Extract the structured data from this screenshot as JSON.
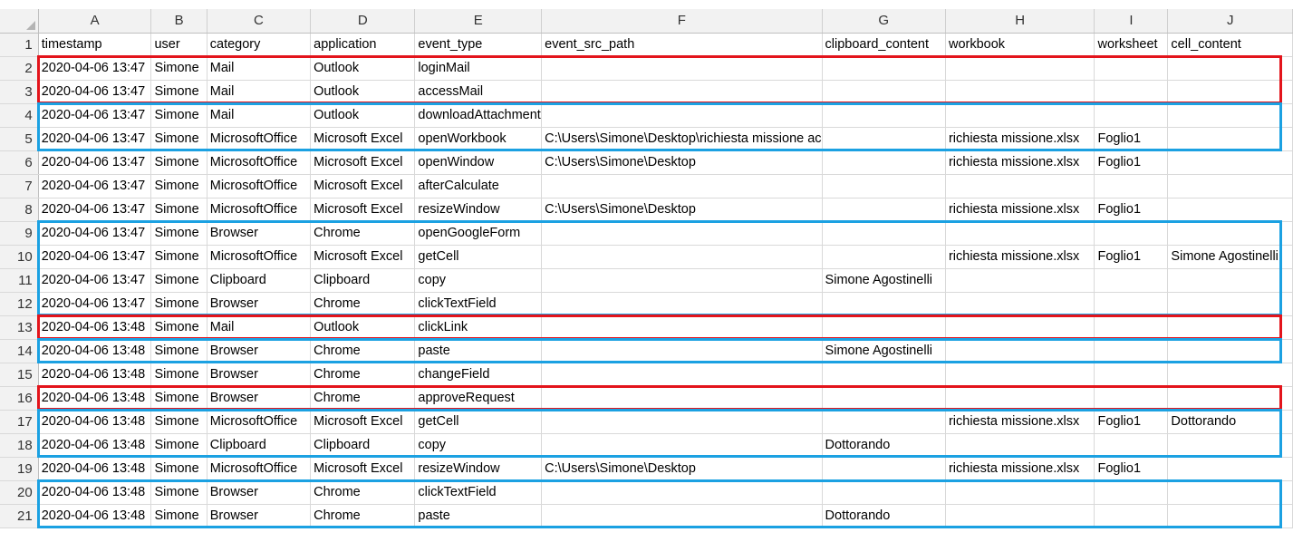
{
  "columns": [
    "A",
    "B",
    "C",
    "D",
    "E",
    "F",
    "G",
    "H",
    "I",
    "J"
  ],
  "rows": [
    {
      "num": "1",
      "cells": [
        "timestamp",
        "user",
        "category",
        "application",
        "event_type",
        "event_src_path",
        "clipboard_content",
        "workbook",
        "worksheet",
        "cell_content"
      ]
    },
    {
      "num": "2",
      "cells": [
        "2020-04-06 13:47",
        "Simone",
        "Mail",
        "Outlook",
        "loginMail",
        "",
        "",
        "",
        "",
        ""
      ]
    },
    {
      "num": "3",
      "cells": [
        "2020-04-06 13:47",
        "Simone",
        "Mail",
        "Outlook",
        "accessMail",
        "",
        "",
        "",
        "",
        ""
      ]
    },
    {
      "num": "4",
      "cells": [
        "2020-04-06 13:47",
        "Simone",
        "Mail",
        "Outlook",
        "downloadAttachment",
        "",
        "",
        "",
        "",
        ""
      ]
    },
    {
      "num": "5",
      "cells": [
        "2020-04-06 13:47",
        "Simone",
        "MicrosoftOffice",
        "Microsoft Excel",
        "openWorkbook",
        "C:\\Users\\Simone\\Desktop\\richiesta missione ac",
        "",
        "richiesta missione.xlsx",
        "Foglio1",
        ""
      ]
    },
    {
      "num": "6",
      "cells": [
        "2020-04-06 13:47",
        "Simone",
        "MicrosoftOffice",
        "Microsoft Excel",
        "openWindow",
        "C:\\Users\\Simone\\Desktop",
        "",
        "richiesta missione.xlsx",
        "Foglio1",
        ""
      ]
    },
    {
      "num": "7",
      "cells": [
        "2020-04-06 13:47",
        "Simone",
        "MicrosoftOffice",
        "Microsoft Excel",
        "afterCalculate",
        "",
        "",
        "",
        "",
        ""
      ]
    },
    {
      "num": "8",
      "cells": [
        "2020-04-06 13:47",
        "Simone",
        "MicrosoftOffice",
        "Microsoft Excel",
        "resizeWindow",
        "C:\\Users\\Simone\\Desktop",
        "",
        "richiesta missione.xlsx",
        "Foglio1",
        ""
      ]
    },
    {
      "num": "9",
      "cells": [
        "2020-04-06 13:47",
        "Simone",
        "Browser",
        "Chrome",
        "openGoogleForm",
        "",
        "",
        "",
        "",
        ""
      ]
    },
    {
      "num": "10",
      "cells": [
        "2020-04-06 13:47",
        "Simone",
        "MicrosoftOffice",
        "Microsoft Excel",
        "getCell",
        "",
        "",
        "richiesta missione.xlsx",
        "Foglio1",
        "Simone Agostinelli"
      ]
    },
    {
      "num": "11",
      "cells": [
        "2020-04-06 13:47",
        "Simone",
        "Clipboard",
        "Clipboard",
        "copy",
        "",
        "Simone Agostinelli",
        "",
        "",
        ""
      ]
    },
    {
      "num": "12",
      "cells": [
        "2020-04-06 13:47",
        "Simone",
        "Browser",
        "Chrome",
        "clickTextField",
        "",
        "",
        "",
        "",
        ""
      ]
    },
    {
      "num": "13",
      "cells": [
        "2020-04-06 13:48",
        "Simone",
        "Mail",
        "Outlook",
        "clickLink",
        "",
        "",
        "",
        "",
        ""
      ]
    },
    {
      "num": "14",
      "cells": [
        "2020-04-06 13:48",
        "Simone",
        "Browser",
        "Chrome",
        "paste",
        "",
        "Simone Agostinelli",
        "",
        "",
        ""
      ]
    },
    {
      "num": "15",
      "cells": [
        "2020-04-06 13:48",
        "Simone",
        "Browser",
        "Chrome",
        "changeField",
        "",
        "",
        "",
        "",
        ""
      ]
    },
    {
      "num": "16",
      "cells": [
        "2020-04-06 13:48",
        "Simone",
        "Browser",
        "Chrome",
        "approveRequest",
        "",
        "",
        "",
        "",
        ""
      ]
    },
    {
      "num": "17",
      "cells": [
        "2020-04-06 13:48",
        "Simone",
        "MicrosoftOffice",
        "Microsoft Excel",
        "getCell",
        "",
        "",
        "richiesta missione.xlsx",
        "Foglio1",
        "Dottorando"
      ]
    },
    {
      "num": "18",
      "cells": [
        "2020-04-06 13:48",
        "Simone",
        "Clipboard",
        "Clipboard",
        "copy",
        "",
        "Dottorando",
        "",
        "",
        ""
      ]
    },
    {
      "num": "19",
      "cells": [
        "2020-04-06 13:48",
        "Simone",
        "MicrosoftOffice",
        "Microsoft Excel",
        "resizeWindow",
        "C:\\Users\\Simone\\Desktop",
        "",
        "richiesta missione.xlsx",
        "Foglio1",
        ""
      ]
    },
    {
      "num": "20",
      "cells": [
        "2020-04-06 13:48",
        "Simone",
        "Browser",
        "Chrome",
        "clickTextField",
        "",
        "",
        "",
        "",
        ""
      ]
    },
    {
      "num": "21",
      "cells": [
        "2020-04-06 13:48",
        "Simone",
        "Browser",
        "Chrome",
        "paste",
        "",
        "Dottorando",
        "",
        "",
        ""
      ]
    }
  ],
  "highlights": [
    {
      "color": "#e3141b",
      "rows": [
        "2",
        "3"
      ]
    },
    {
      "color": "#1ba1e2",
      "rows": [
        "4",
        "5"
      ]
    },
    {
      "color": "#1ba1e2",
      "rows": [
        "9",
        "12"
      ]
    },
    {
      "color": "#e3141b",
      "rows": [
        "13",
        "13"
      ]
    },
    {
      "color": "#1ba1e2",
      "rows": [
        "14",
        "14"
      ]
    },
    {
      "color": "#e3141b",
      "rows": [
        "16",
        "16"
      ]
    },
    {
      "color": "#1ba1e2",
      "rows": [
        "17",
        "18"
      ]
    },
    {
      "color": "#1ba1e2",
      "rows": [
        "20",
        "21"
      ]
    }
  ]
}
